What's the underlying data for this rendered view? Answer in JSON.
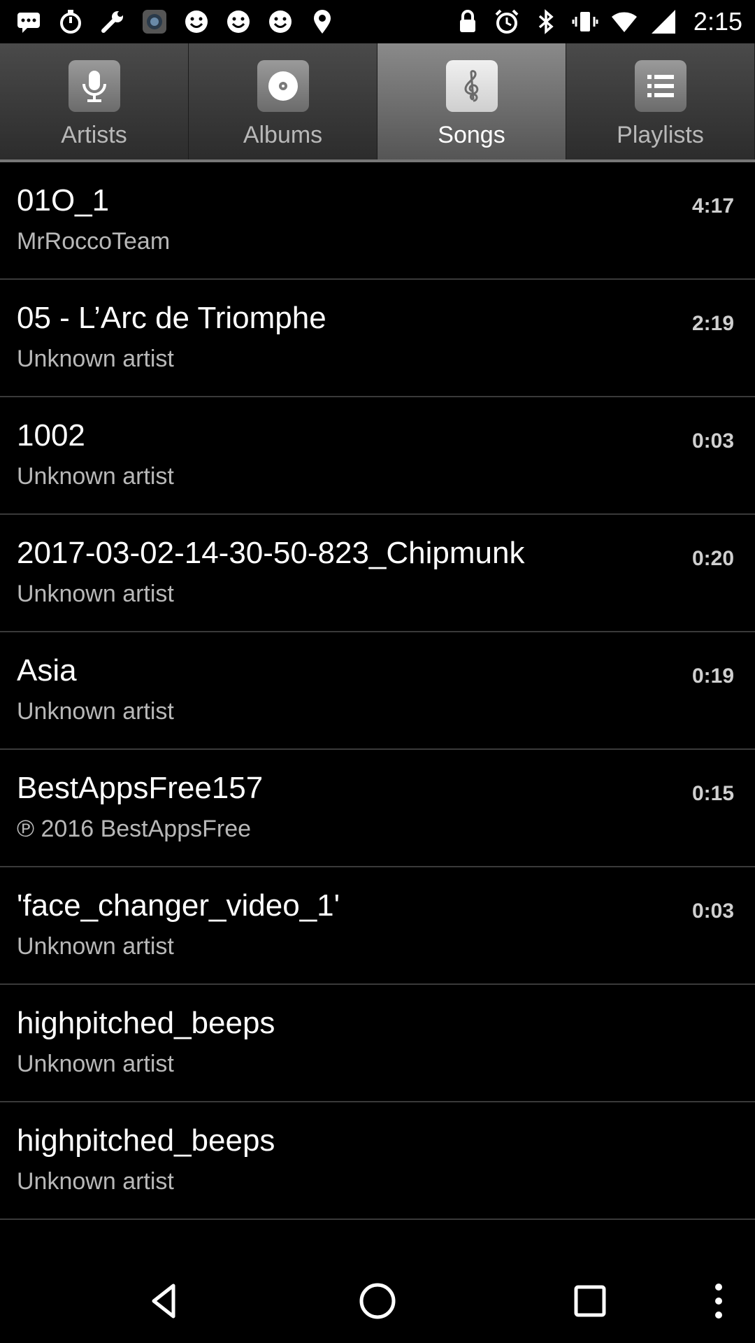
{
  "status_bar": {
    "time": "2:15",
    "left_icons": [
      "message-icon",
      "timer-icon",
      "wrench-icon",
      "app-icon",
      "smiley-icon",
      "smiley-icon",
      "smiley-icon",
      "fake-gps-icon"
    ],
    "right_icons": [
      "lock-icon",
      "alarm-icon",
      "bluetooth-icon",
      "vibrate-icon",
      "wifi-icon",
      "signal-icon"
    ]
  },
  "tabs": [
    {
      "label": "Artists",
      "icon": "microphone-icon",
      "active": false
    },
    {
      "label": "Albums",
      "icon": "disc-icon",
      "active": false
    },
    {
      "label": "Songs",
      "icon": "treble-clef-icon",
      "active": true
    },
    {
      "label": "Playlists",
      "icon": "list-icon",
      "active": false
    }
  ],
  "songs": [
    {
      "title": "01O_1",
      "artist": "MrRoccoTeam",
      "duration": "4:17"
    },
    {
      "title": "05 - L’Arc de Triomphe",
      "artist": "Unknown artist",
      "duration": "2:19"
    },
    {
      "title": "1002",
      "artist": "Unknown artist",
      "duration": "0:03"
    },
    {
      "title": "2017-03-02-14-30-50-823_Chipmunk",
      "artist": "Unknown artist",
      "duration": "0:20"
    },
    {
      "title": "Asia",
      "artist": "Unknown artist",
      "duration": "0:19"
    },
    {
      "title": "BestAppsFree157",
      "artist": "℗ 2016 BestAppsFree",
      "duration": "0:15"
    },
    {
      "title": "'face_changer_video_1'",
      "artist": "Unknown artist",
      "duration": "0:03"
    },
    {
      "title": "highpitched_beeps",
      "artist": "Unknown artist",
      "duration": ""
    },
    {
      "title": "highpitched_beeps",
      "artist": "Unknown artist",
      "duration": ""
    }
  ],
  "nav_bar": {
    "buttons": [
      "back-icon",
      "home-icon",
      "recents-icon",
      "overflow-menu-icon"
    ]
  },
  "colors": {
    "background": "#000000",
    "tab_bar": "#3a3a3a",
    "tab_active": "#7a7a7a",
    "primary_text": "#ffffff",
    "secondary_text": "#b8b8b8",
    "divider": "#3a3a3a"
  }
}
